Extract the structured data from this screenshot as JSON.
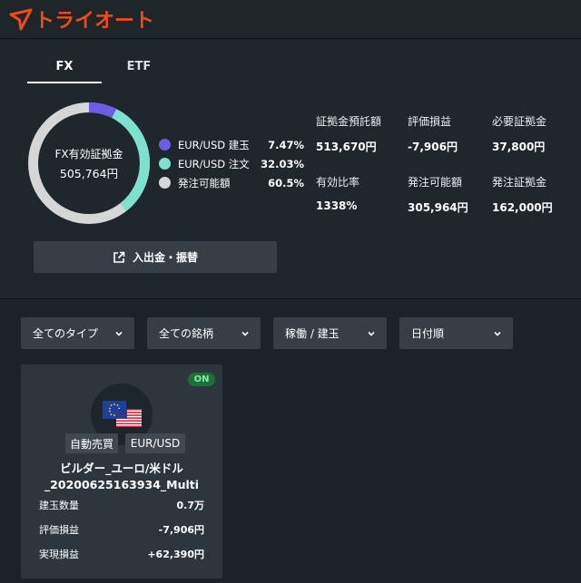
{
  "app": {
    "logo_text": "トライオート",
    "brand_color": "#f04a1b"
  },
  "tabs": [
    {
      "label": "FX",
      "active": true
    },
    {
      "label": "ETF",
      "active": false
    }
  ],
  "summary": {
    "donut_label": "FX有効証拠金",
    "donut_value": "505,764円",
    "legend": [
      {
        "label": "EUR/USD 建玉",
        "pct": "7.47%",
        "fraction": 0.0747,
        "color": "#6c5ce7"
      },
      {
        "label": "EUR/USD 注文",
        "pct": "32.03%",
        "fraction": 0.3203,
        "color": "#7ee0cf"
      },
      {
        "label": "発注可能額",
        "pct": "60.5%",
        "fraction": 0.605,
        "color": "#d6d6d6"
      }
    ],
    "stats": [
      {
        "label": "証拠金預託額",
        "value": "513,670円"
      },
      {
        "label": "評価損益",
        "value": "-7,906円"
      },
      {
        "label": "必要証拠金",
        "value": "37,800円"
      },
      {
        "label": "有効比率",
        "value": "1338%"
      },
      {
        "label": "発注可能額",
        "value": "305,964円"
      },
      {
        "label": "発注証拠金",
        "value": "162,000円"
      }
    ],
    "transfer_button": "入出金・振替"
  },
  "filters": [
    {
      "label": "全てのタイプ"
    },
    {
      "label": "全ての銘柄"
    },
    {
      "label": "稼働 / 建玉"
    },
    {
      "label": "日付順"
    }
  ],
  "card": {
    "status": "ON",
    "tags": [
      "自動売買",
      "EUR/USD"
    ],
    "title_line1": "ビルダー_ユーロ/米ドル",
    "title_line2": "_20200625163934_Multi",
    "rows": [
      {
        "label": "建玉数量",
        "value": "0.7万"
      },
      {
        "label": "評価損益",
        "value": "-7,906円"
      },
      {
        "label": "実現損益",
        "value": "+62,390円"
      }
    ]
  }
}
